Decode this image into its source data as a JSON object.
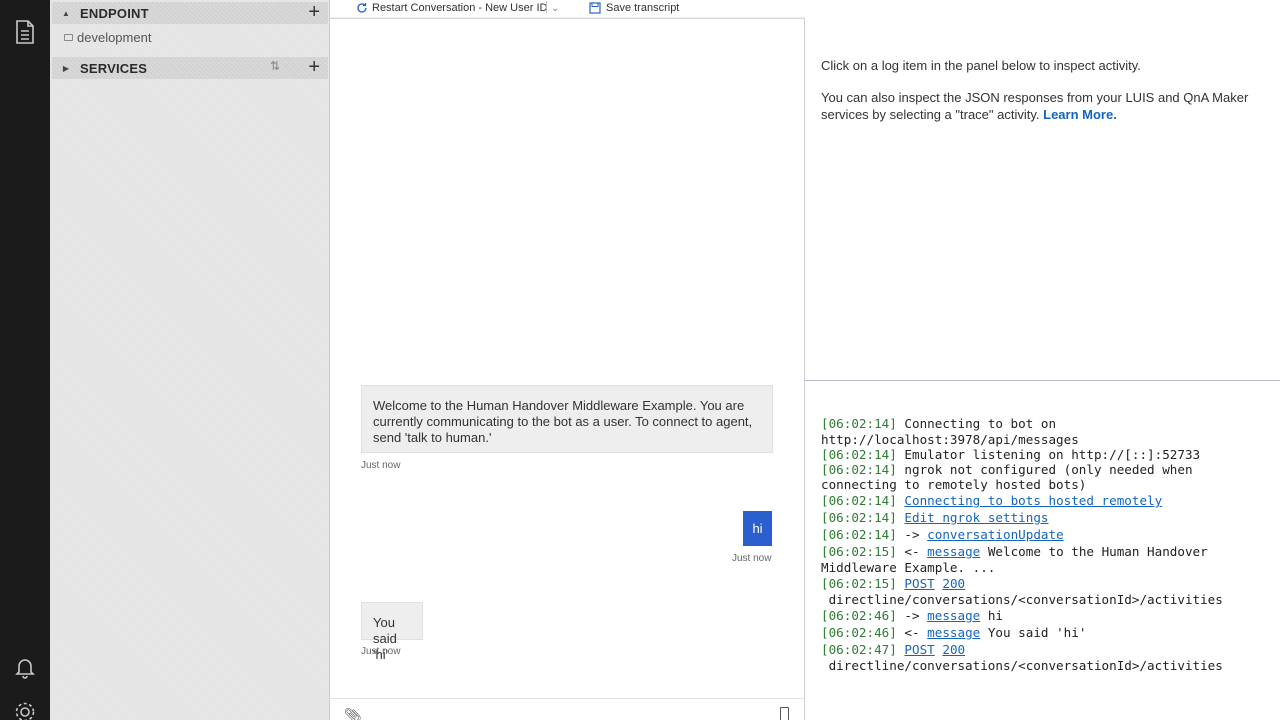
{
  "sidebar": {
    "endpoint_title": "ENDPOINT",
    "endpoint_item": "development",
    "services_title": "SERVICES"
  },
  "toolbar": {
    "restart_label": "Restart Conversation - New User ID",
    "save_label": "Save transcript"
  },
  "chat": {
    "welcome_message": "Welcome to the Human Handover Middleware Example. You are currently communicating to the bot as a user. To connect to agent, send 'talk to human.'",
    "welcome_time": "Just now",
    "user_message": "hi",
    "user_time": "Just now",
    "echo_message": "You said 'hi'",
    "echo_time": "Just now"
  },
  "inspector": {
    "hint": "Click on a log item in the panel below to inspect activity.",
    "json_hint": "You can also inspect the JSON responses from your LUIS and QnA Maker services by selecting a \"trace\" activity.",
    "learn_more": "Learn More."
  },
  "log": {
    "l1_time": "[06:02:14]",
    "l1_text": " Connecting to bot on",
    "l1b_text": "http://localhost:3978/api/messages",
    "l2_time": "[06:02:14]",
    "l2_text": " Emulator listening on http://[::]:52733",
    "l3_time": "[06:02:14]",
    "l3_text": " ngrok not configured (only needed when",
    "l3b_text": "connecting to remotely hosted bots)",
    "l4_time": "[06:02:14]",
    "l4_link": "Connecting to bots hosted remotely",
    "l5_time": "[06:02:14]",
    "l5_link": "Edit ngrok settings",
    "l6_time": "[06:02:14]",
    "l6_arrow": " -> ",
    "l6_link": "conversationUpdate",
    "l7_time": "[06:02:15]",
    "l7_arrow": " <- ",
    "l7_link": "message",
    "l7_text": " Welcome to the Human Handover",
    "l7b_text": "Middleware Example. ...",
    "l8_time": "[06:02:15]",
    "l8_method": "POST",
    "l8_status": "200",
    "l8b_text": " directline/conversations/<conversationId>/activities",
    "l9_time": "[06:02:46]",
    "l9_arrow": " -> ",
    "l9_link": "message",
    "l9_text": " hi",
    "l10_time": "[06:02:46]",
    "l10_arrow": " <- ",
    "l10_link": "message",
    "l10_text": " You said 'hi'",
    "l11_time": "[06:02:47]",
    "l11_method": "POST",
    "l11_status": "200",
    "l11b_text": " directline/conversations/<conversationId>/activities"
  }
}
